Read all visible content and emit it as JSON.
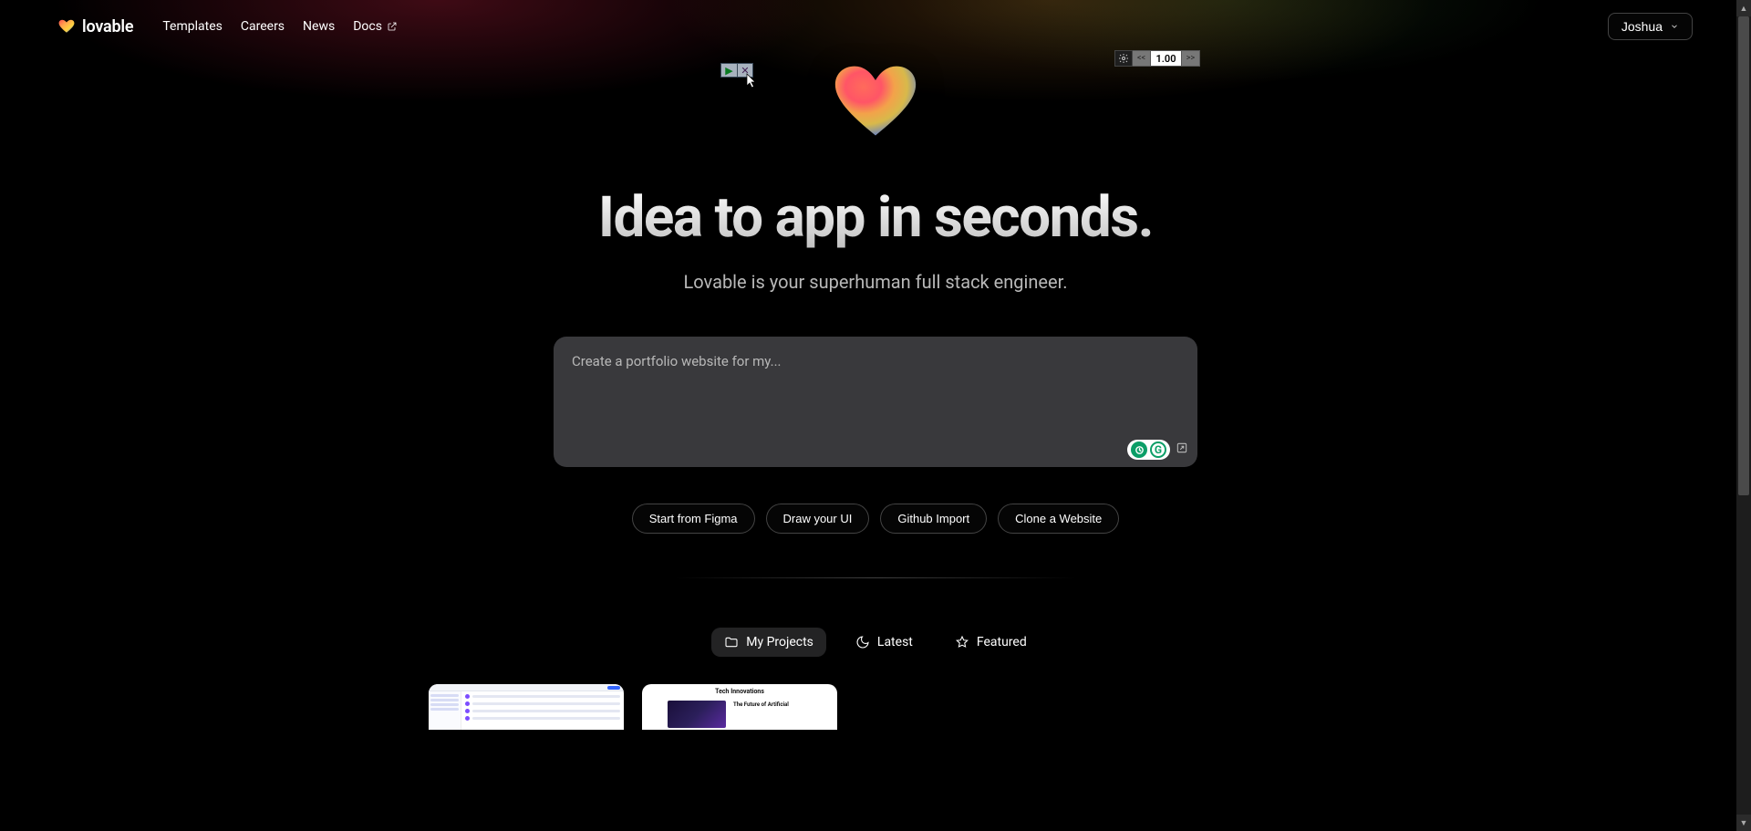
{
  "brand": {
    "name": "lovable"
  },
  "nav": {
    "templates": "Templates",
    "careers": "Careers",
    "news": "News",
    "docs": "Docs"
  },
  "user": {
    "name": "Joshua"
  },
  "hero": {
    "headline": "Idea to app in seconds.",
    "subhead": "Lovable is your superhuman full stack engineer."
  },
  "prompt": {
    "placeholder": "Create a portfolio website for my..."
  },
  "quick_actions": {
    "figma": "Start from Figma",
    "draw": "Draw your UI",
    "github": "Github Import",
    "clone": "Clone a Website"
  },
  "tabs": {
    "my_projects": "My Projects",
    "latest": "Latest",
    "featured": "Featured"
  },
  "zoom": {
    "value": "1.00",
    "prev": "<<",
    "next": ">>"
  },
  "card2": {
    "title": "Tech Innovations",
    "headline": "The Future of Artificial"
  },
  "grammarly": {
    "letter": "G"
  }
}
